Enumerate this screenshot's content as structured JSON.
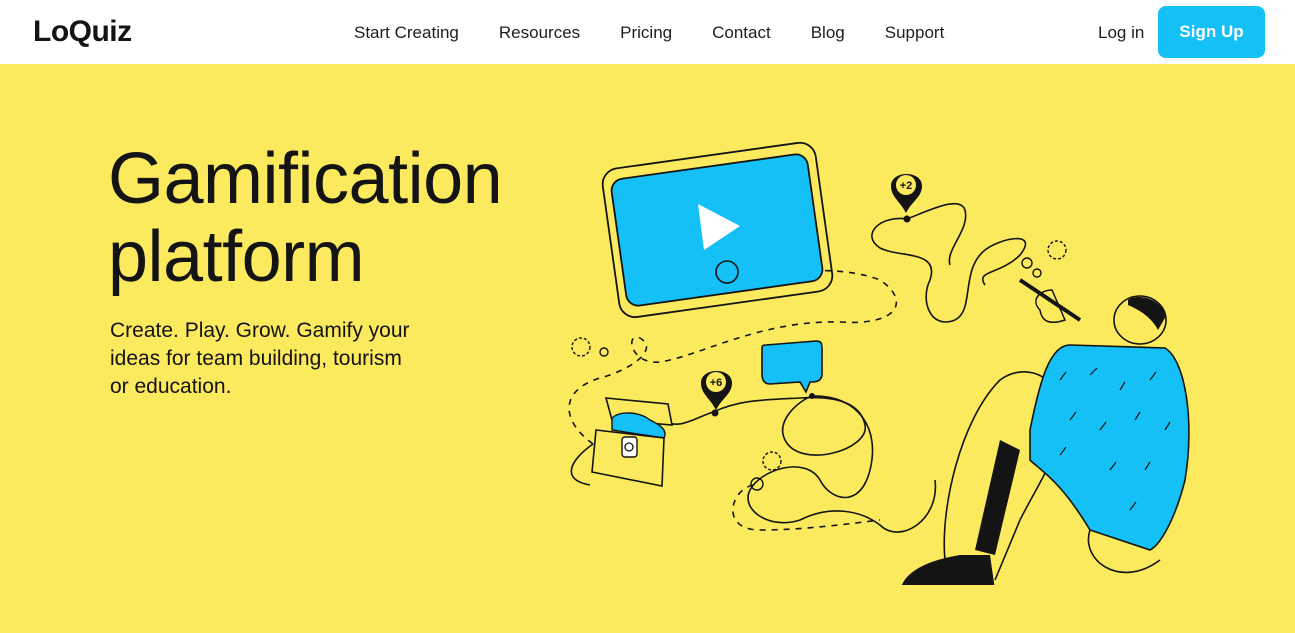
{
  "header": {
    "logo": "LoQuiz",
    "nav": [
      {
        "label": "Start Creating"
      },
      {
        "label": "Resources"
      },
      {
        "label": "Pricing"
      },
      {
        "label": "Contact"
      },
      {
        "label": "Blog"
      },
      {
        "label": "Support"
      }
    ],
    "login_label": "Log in",
    "signup_label": "Sign Up"
  },
  "hero": {
    "title": "Gamification platform",
    "subtitle": "Create. Play. Grow. Gamify your ideas for team building, tourism or education.",
    "illustration": {
      "badge_top": "+2",
      "badge_left": "+6",
      "icons": [
        "video-player-icon",
        "play-icon",
        "treasure-chest-icon",
        "chat-bubble-icon",
        "gear-icon",
        "person-with-pencil-illustration"
      ]
    }
  },
  "colors": {
    "hero_background": "#fbe95e",
    "accent_blue": "#14c0f5",
    "text_dark": "#141414",
    "page_background": "#ffffff"
  }
}
